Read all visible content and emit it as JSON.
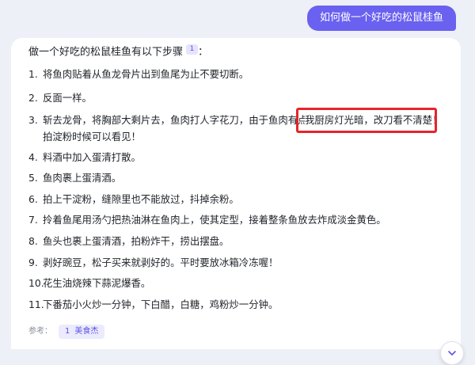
{
  "user_message": "如何做一个好吃的松鼠桂鱼",
  "answer": {
    "intro": "做一个好吃的松鼠桂鱼有以下步骤",
    "intro_cite": "1",
    "intro_suffix": "：",
    "steps": [
      {
        "num": "1.",
        "text": "将鱼肉贴着从鱼龙骨片出到鱼尾为止不要切断。"
      },
      {
        "num": "2.",
        "text": "反面一样。"
      },
      {
        "num": "3.",
        "text": "斩去龙骨，将胸部大剩片去，鱼肉打人字花刀，由于鱼肉有点透明",
        "text2": "拍淀粉时候可以看见！"
      },
      {
        "num": "4.",
        "text": "料酒中加入蛋清打散。"
      },
      {
        "num": "5.",
        "text": "鱼肉裹上蛋清酒。"
      },
      {
        "num": "6.",
        "text": "拍上干淀粉，缝隙里也不能放过，抖掉余粉。"
      },
      {
        "num": "7.",
        "text": "拎着鱼尾用汤勺把热油淋在鱼肉上，使其定型，接着整条鱼放去炸成淡金黄色。"
      },
      {
        "num": "8.",
        "text": "鱼头也裹上蛋清酒，拍粉炸干，捞出摆盘。"
      },
      {
        "num": "9.",
        "text": "剥好豌豆，松子买来就剥好的。平时要放冰箱冷冻喔！"
      },
      {
        "num": "10.",
        "text": "花生油烧辣下蒜泥爆香。"
      },
      {
        "num": "11.",
        "text": "下番茄小火炒一分钟，下白醋，白糖，鸡粉炒一分钟。"
      }
    ],
    "annotation": "我厨房灯光暗，改刀看不清楚！"
  },
  "references": {
    "label": "参考：",
    "items": [
      {
        "num": "1",
        "name": "美食杰"
      }
    ]
  },
  "colors": {
    "user_bubble": "#6a61f0",
    "highlight_border": "#e3262a",
    "accent": "#5b53e6"
  },
  "icons": {
    "scroll_down": "chevron-down-icon"
  }
}
